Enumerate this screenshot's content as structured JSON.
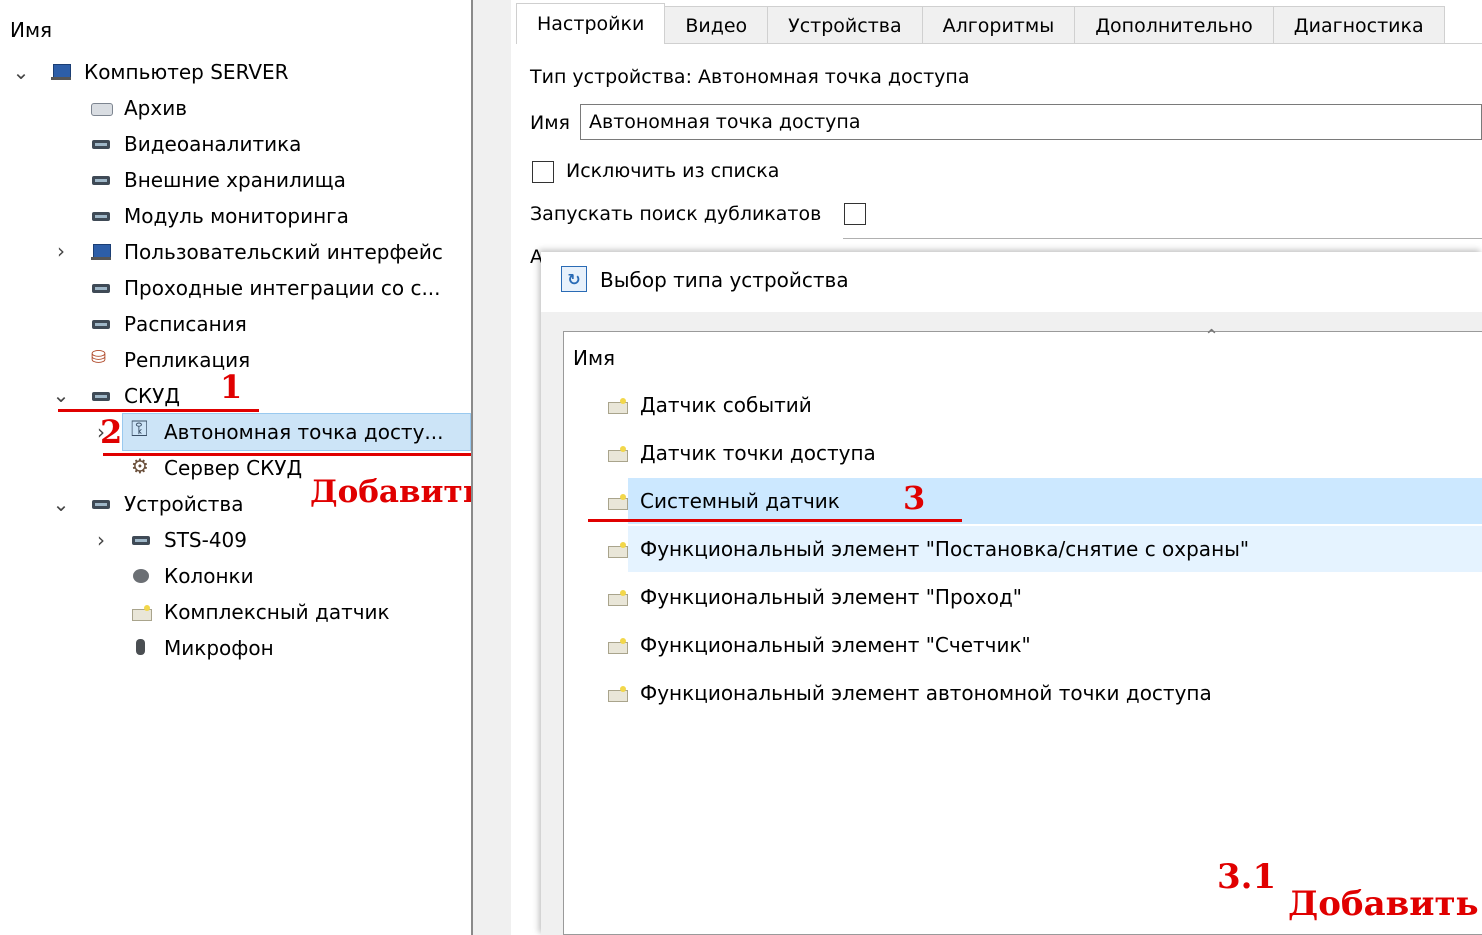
{
  "tree": {
    "header": "Имя",
    "nodes": [
      {
        "label": "Компьютер SERVER"
      },
      {
        "label": "Архив"
      },
      {
        "label": "Видеоаналитика"
      },
      {
        "label": "Внешние хранилища"
      },
      {
        "label": "Модуль мониторинга"
      },
      {
        "label": "Пользовательский интерфейс"
      },
      {
        "label": "Проходные интеграции со с..."
      },
      {
        "label": "Расписания"
      },
      {
        "label": "Репликация"
      },
      {
        "label": "СКУД"
      },
      {
        "label": "Автономная точка досту..."
      },
      {
        "label": "Сервер СКУД"
      },
      {
        "label": "Устройства"
      },
      {
        "label": "STS-409"
      },
      {
        "label": "Колонки"
      },
      {
        "label": "Комплексный датчик"
      },
      {
        "label": "Микрофон"
      }
    ]
  },
  "annotations": {
    "step1": "1",
    "step2": "2",
    "add_left": "Добавить",
    "step3": "3",
    "step31": "3.1",
    "add_right": "Добавить",
    "color": "#e00000"
  },
  "tabs": [
    "Настройки",
    "Видео",
    "Устройства",
    "Алгоритмы",
    "Дополнительно",
    "Диагностика"
  ],
  "settings": {
    "device_type": "Тип устройства: Автономная точка доступа",
    "name_label": "Имя",
    "name_value": "Автономная точка доступа",
    "exclude_label": "Исключить из списка",
    "dup_search_label": "Запускать поиск дубликатов",
    "partial_label": "А"
  },
  "dialog": {
    "title": "Выбор типа устройства",
    "icon": "refresh-icon",
    "list_header": "Имя",
    "items": [
      "Датчик событий",
      "Датчик точки доступа",
      "Системный датчик",
      "Функциональный элемент \"Постановка/снятие с охраны\"",
      "Функциональный элемент \"Проход\"",
      "Функциональный элемент \"Счетчик\"",
      "Функциональный элемент автономной точки доступа"
    ],
    "selected_color": "#cce8ff",
    "hover_color": "#e5f3ff"
  }
}
